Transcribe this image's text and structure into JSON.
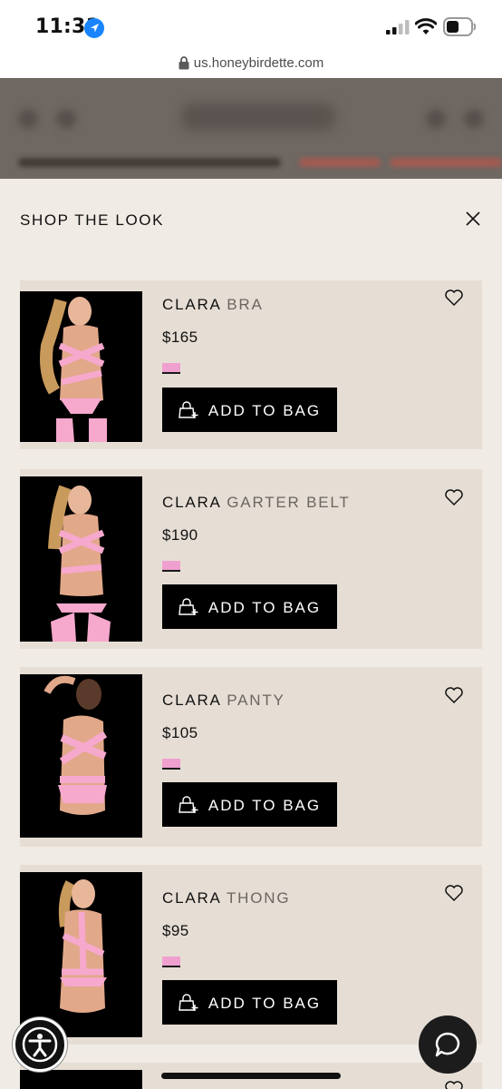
{
  "status_bar": {
    "time": "11:31",
    "icons": [
      "location-arrow-icon",
      "cellular-signal-icon",
      "wifi-icon",
      "battery-icon"
    ]
  },
  "browser": {
    "url": "us.honeybirdette.com"
  },
  "panel": {
    "title": "SHOP THE LOOK",
    "close_icon": "close-icon"
  },
  "products": [
    {
      "brand": "CLARA",
      "type": "BRA",
      "price": "$165",
      "swatch_color": "#f0a0cf",
      "button_label": "ADD TO BAG"
    },
    {
      "brand": "CLARA",
      "type": "GARTER BELT",
      "price": "$190",
      "swatch_color": "#f0a0cf",
      "button_label": "ADD TO BAG"
    },
    {
      "brand": "CLARA",
      "type": "PANTY",
      "price": "$105",
      "swatch_color": "#f0a0cf",
      "button_label": "ADD TO BAG"
    },
    {
      "brand": "CLARA",
      "type": "THONG",
      "price": "$95",
      "swatch_color": "#f0a0cf",
      "button_label": "ADD TO BAG"
    }
  ],
  "colors": {
    "panel_bg": "#f0ebe5",
    "card_bg": "#e6ded5",
    "button_bg": "#000000",
    "accent_pink": "#f0a0cf"
  },
  "floating": {
    "accessibility_icon": "accessibility-icon",
    "chat_icon": "chat-bubble-icon"
  }
}
